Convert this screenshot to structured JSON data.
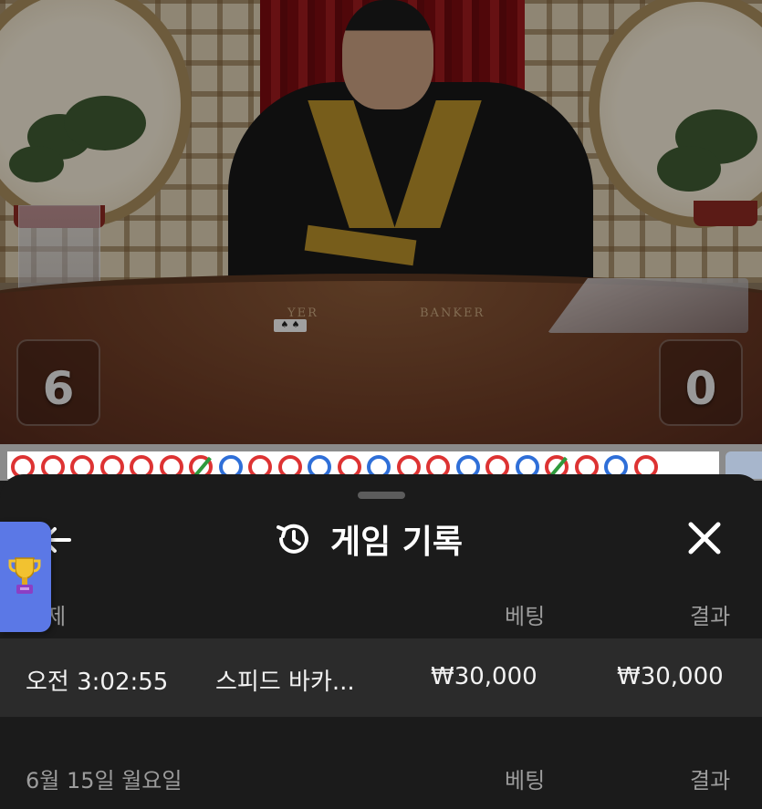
{
  "video": {
    "table_labels": {
      "player": "YER",
      "banker": "BANKER"
    },
    "scores": {
      "player": "6",
      "banker": "0"
    }
  },
  "road": {
    "beads": [
      "b",
      "b",
      "b",
      "b",
      "b",
      "b",
      "bp",
      "p",
      "b",
      "b",
      "p",
      "b",
      "p",
      "b",
      "b",
      "p",
      "b",
      "p",
      "bp",
      "b",
      "p",
      "b"
    ]
  },
  "sheet": {
    "title": "게임 기록",
    "icons": {
      "back": "back-arrow-icon",
      "history": "history-icon",
      "close": "close-icon",
      "trophy": "trophy-icon"
    },
    "groups": [
      {
        "date": "어제",
        "bet_header": "베팅",
        "result_header": "결과",
        "rows": [
          {
            "time": "오전 3:02:55",
            "game": "스피드 바카...",
            "bet": "₩30,000",
            "result": "₩30,000"
          }
        ]
      },
      {
        "date": "6월 15일 월요일",
        "bet_header": "베팅",
        "result_header": "결과",
        "rows": []
      }
    ]
  },
  "colors": {
    "sheet_bg": "#1b1b1b",
    "row_bg": "#2b2b2b",
    "banker_red": "#dd3333",
    "player_blue": "#2f6fd8",
    "trophy_tab": "#5b78e6"
  }
}
